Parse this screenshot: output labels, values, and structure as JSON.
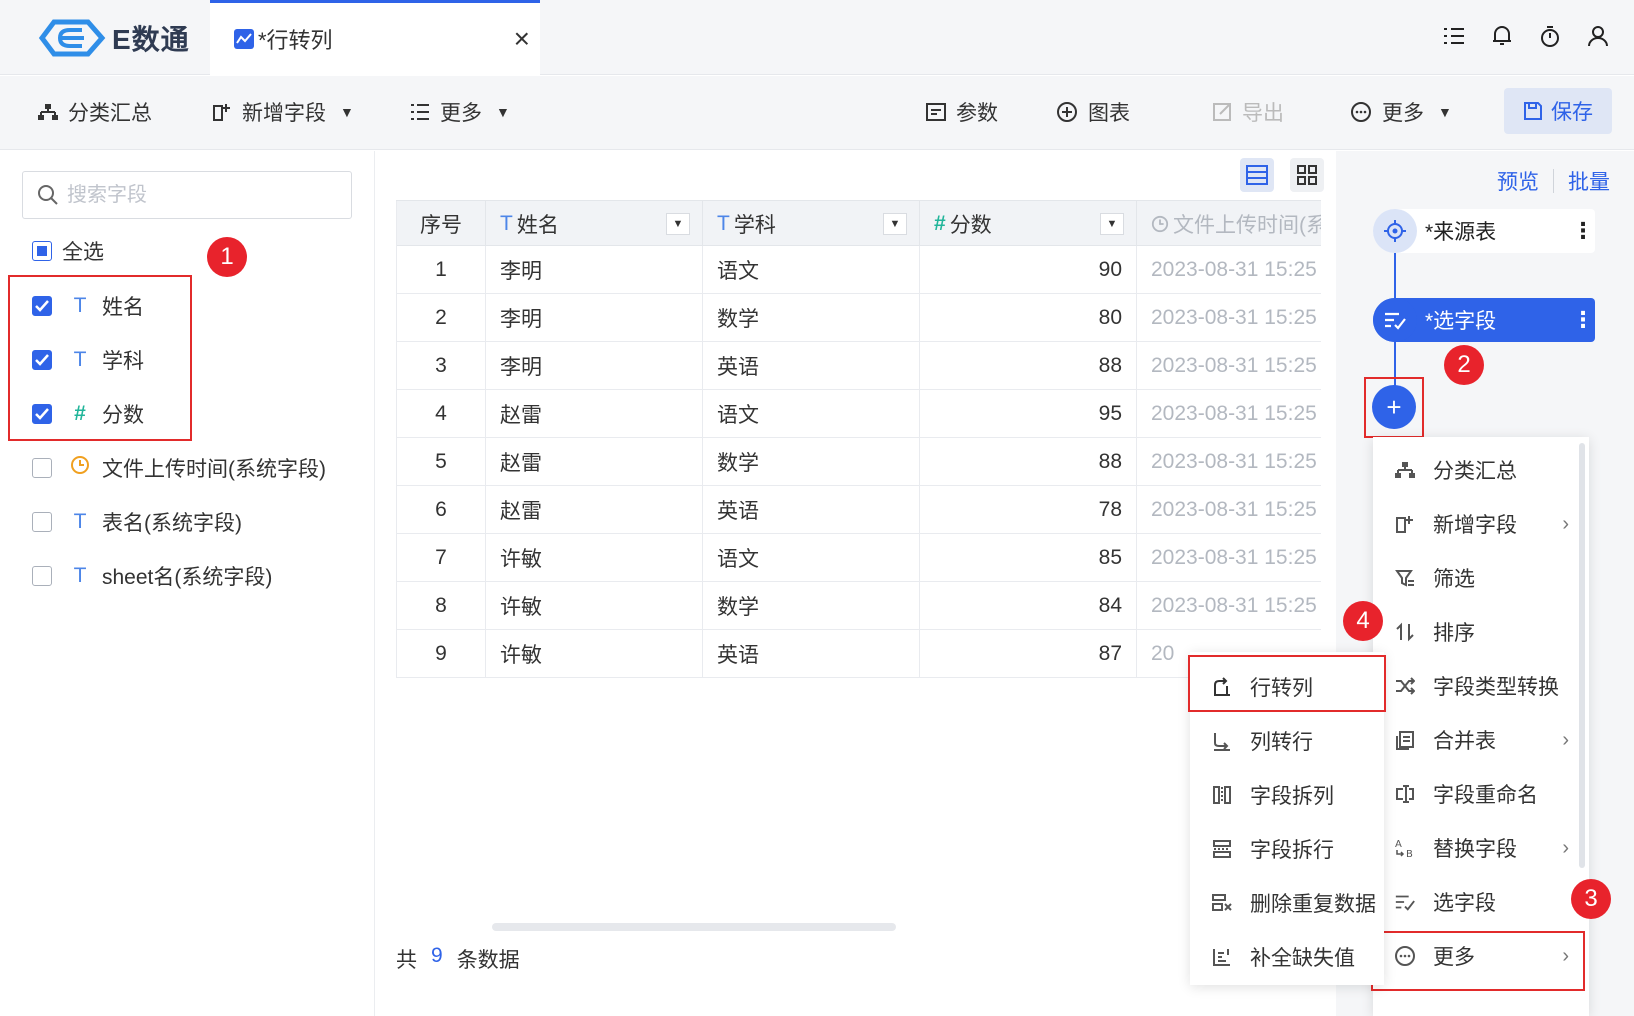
{
  "app": {
    "logo_text": "E数通"
  },
  "tab": {
    "label": "*行转列",
    "close": "×"
  },
  "toolbar": {
    "group_summary": "分类汇总",
    "add_field": "新增字段",
    "more_left": "更多",
    "params": "参数",
    "chart": "图表",
    "export": "导出",
    "more_right": "更多",
    "save": "保存"
  },
  "fields_panel": {
    "search_placeholder": "搜索字段",
    "select_all": "全选",
    "fields": [
      {
        "type_symbol": "T",
        "name": "姓名",
        "checked": true
      },
      {
        "type_symbol": "T",
        "name": "学科",
        "checked": true
      },
      {
        "type_symbol": "#",
        "name": "分数",
        "checked": true
      },
      {
        "type_symbol": "clock",
        "name": "文件上传时间(系统字段)",
        "checked": false
      },
      {
        "type_symbol": "T",
        "name": "表名(系统字段)",
        "checked": false
      },
      {
        "type_symbol": "T",
        "name": "sheet名(系统字段)",
        "checked": false
      }
    ]
  },
  "table": {
    "headers": {
      "index": "序号",
      "name_type": "T",
      "name": "姓名",
      "subject_type": "T",
      "subject": "学科",
      "score_type": "#",
      "score": "分数",
      "time": "文件上传时间(系"
    },
    "rows": [
      [
        "1",
        "李明",
        "语文",
        "90",
        "2023-08-31 15:25"
      ],
      [
        "2",
        "李明",
        "数学",
        "80",
        "2023-08-31 15:25"
      ],
      [
        "3",
        "李明",
        "英语",
        "88",
        "2023-08-31 15:25"
      ],
      [
        "4",
        "赵雷",
        "语文",
        "95",
        "2023-08-31 15:25"
      ],
      [
        "5",
        "赵雷",
        "数学",
        "88",
        "2023-08-31 15:25"
      ],
      [
        "6",
        "赵雷",
        "英语",
        "78",
        "2023-08-31 15:25"
      ],
      [
        "7",
        "许敏",
        "语文",
        "85",
        "2023-08-31 15:25"
      ],
      [
        "8",
        "许敏",
        "数学",
        "84",
        "2023-08-31 15:25"
      ],
      [
        "9",
        "许敏",
        "英语",
        "87",
        "20"
      ]
    ],
    "footer": {
      "prefix": "共",
      "count": "9",
      "suffix": "条数据"
    }
  },
  "flow_panel": {
    "preview": "预览",
    "batch": "批量",
    "source_node": "*来源表",
    "select_node": "*选字段",
    "plus": "+"
  },
  "main_menu": [
    {
      "label": "分类汇总",
      "icon": "group-icon",
      "has_sub": false
    },
    {
      "label": "新增字段",
      "icon": "add-field-icon",
      "has_sub": true
    },
    {
      "label": "筛选",
      "icon": "filter-icon",
      "has_sub": false
    },
    {
      "label": "排序",
      "icon": "sort-icon",
      "has_sub": false
    },
    {
      "label": "字段类型转换",
      "icon": "convert-icon",
      "has_sub": false
    },
    {
      "label": "合并表",
      "icon": "merge-icon",
      "has_sub": true
    },
    {
      "label": "字段重命名",
      "icon": "rename-icon",
      "has_sub": false
    },
    {
      "label": "替换字段",
      "icon": "replace-icon",
      "has_sub": true
    },
    {
      "label": "选字段",
      "icon": "select-field-icon",
      "has_sub": false
    },
    {
      "label": "更多",
      "icon": "more-circle-icon",
      "has_sub": true
    }
  ],
  "sub_menu": [
    {
      "label": "行转列",
      "icon": "row-to-col-icon"
    },
    {
      "label": "列转行",
      "icon": "col-to-row-icon"
    },
    {
      "label": "字段拆列",
      "icon": "split-col-icon"
    },
    {
      "label": "字段拆行",
      "icon": "split-row-icon"
    },
    {
      "label": "删除重复数据",
      "icon": "dedupe-icon"
    },
    {
      "label": "补全缺失值",
      "icon": "fill-missing-icon"
    }
  ],
  "annotations": [
    "1",
    "2",
    "3",
    "4"
  ],
  "colors": {
    "accent": "#2f63e8",
    "highlight_red": "#e22b2b",
    "badge_red": "#e8232c"
  }
}
